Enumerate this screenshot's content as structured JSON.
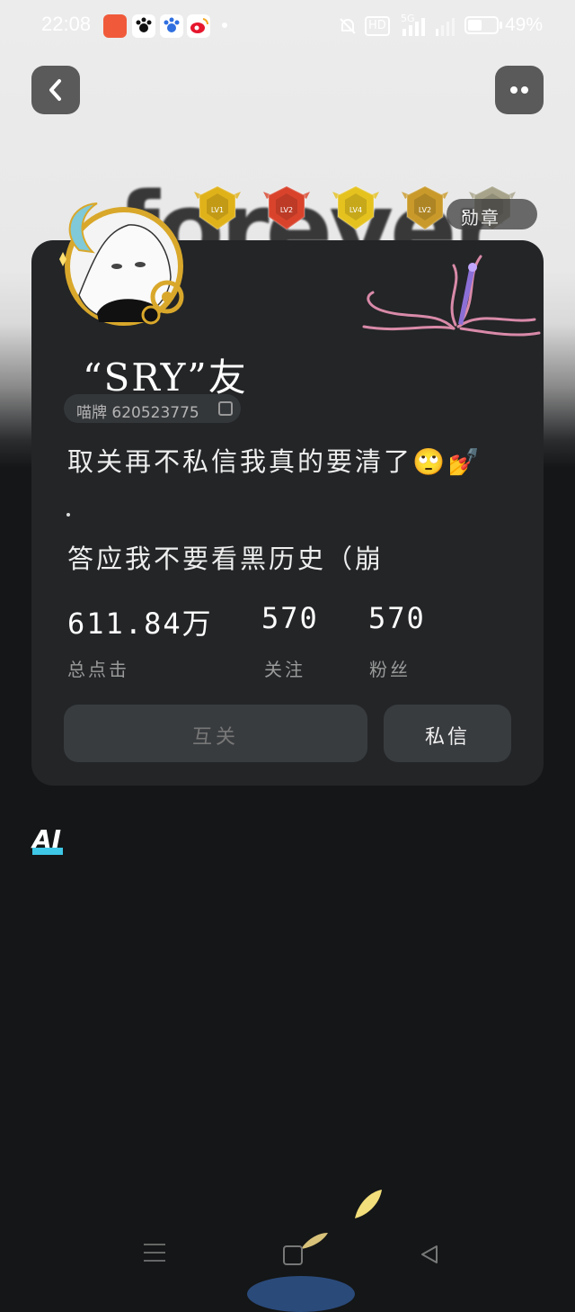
{
  "status_bar": {
    "time": "22:08",
    "signal_label": "HD",
    "network": "5G",
    "battery_percent": "49%",
    "battery_level": 0.49
  },
  "header": {
    "background_word": "forever",
    "medal_button_label": "勋章",
    "badges": [
      {
        "label": "LV1",
        "color": "#e0b21a"
      },
      {
        "label": "LV2",
        "color": "#d9432c"
      },
      {
        "label": "LV4",
        "color": "#e5c21e"
      },
      {
        "label": "LV2",
        "color": "#c99a2a"
      },
      {
        "label": "",
        "color": "#a7a38a"
      }
    ]
  },
  "profile": {
    "name": "“SRY”友",
    "id_label": "喵牌",
    "id_value": "620523775",
    "bio_line1": "取关再不私信我真的要清了🙄💅",
    "bio_line2": "答应我不要看黑历史（崩",
    "stats": [
      {
        "value": "611.84万",
        "label": "总点击"
      },
      {
        "value": "570",
        "label": "关注"
      },
      {
        "value": "570",
        "label": "粉丝"
      }
    ],
    "mutual_button": "互关",
    "message_button": "私信"
  },
  "ai_tag": "AI",
  "colors": {
    "card_bg": "#232527",
    "page_bg": "#141617",
    "button_bg": "#393c3f",
    "ai_accent": "#3ec7e6"
  }
}
